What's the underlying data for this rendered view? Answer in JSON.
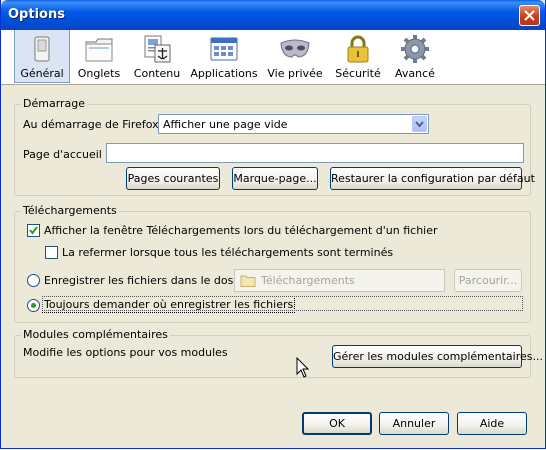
{
  "window": {
    "title": "Options"
  },
  "tabs": [
    {
      "id": "general",
      "label": "Général",
      "icon": "general-switch-icon",
      "selected": true
    },
    {
      "id": "tabs",
      "label": "Onglets",
      "icon": "tabs-folder-icon",
      "selected": false
    },
    {
      "id": "content",
      "label": "Contenu",
      "icon": "content-page-icon",
      "selected": false
    },
    {
      "id": "applications",
      "label": "Applications",
      "icon": "applications-icon",
      "selected": false
    },
    {
      "id": "privacy",
      "label": "Vie privée",
      "icon": "privacy-mask-icon",
      "selected": false
    },
    {
      "id": "security",
      "label": "Sécurité",
      "icon": "security-lock-icon",
      "selected": false
    },
    {
      "id": "advanced",
      "label": "Avancé",
      "icon": "advanced-gear-icon",
      "selected": false
    }
  ],
  "startup": {
    "group_label": "Démarrage",
    "when_label": "Au démarrage de Firefox :",
    "when_value": "Afficher une page vide",
    "home_label": "Page d'accueil :",
    "home_value": "",
    "btn_current": "Pages courantes",
    "btn_bookmark": "Marque-page...",
    "btn_restore": "Restaurer la configuration par défaut"
  },
  "downloads": {
    "group_label": "Téléchargements",
    "show_window_label": "Afficher la fenêtre Téléchargements lors du téléchargement d'un fichier",
    "show_window_checked": true,
    "close_when_done_label": "La refermer lorsque tous les téléchargements sont terminés",
    "close_when_done_checked": false,
    "save_to_label": "Enregistrer les fichiers dans le dossier",
    "folder_value": "Téléchargements",
    "browse_label": "Parcourir...",
    "always_ask_label": "Toujours demander où enregistrer les fichiers",
    "selected_option": "always_ask"
  },
  "addons": {
    "group_label": "Modules complémentaires",
    "desc": "Modifie les options pour vos modules",
    "manage_button": "Gérer les modules complémentaires..."
  },
  "footer": {
    "ok": "OK",
    "cancel": "Annuler",
    "help": "Aide"
  },
  "colors": {
    "titlebar": "#0054e3",
    "dialog_bg": "#ece9d8",
    "selected_tab": "#dbe4f5",
    "radio_dot": "#21a121"
  }
}
